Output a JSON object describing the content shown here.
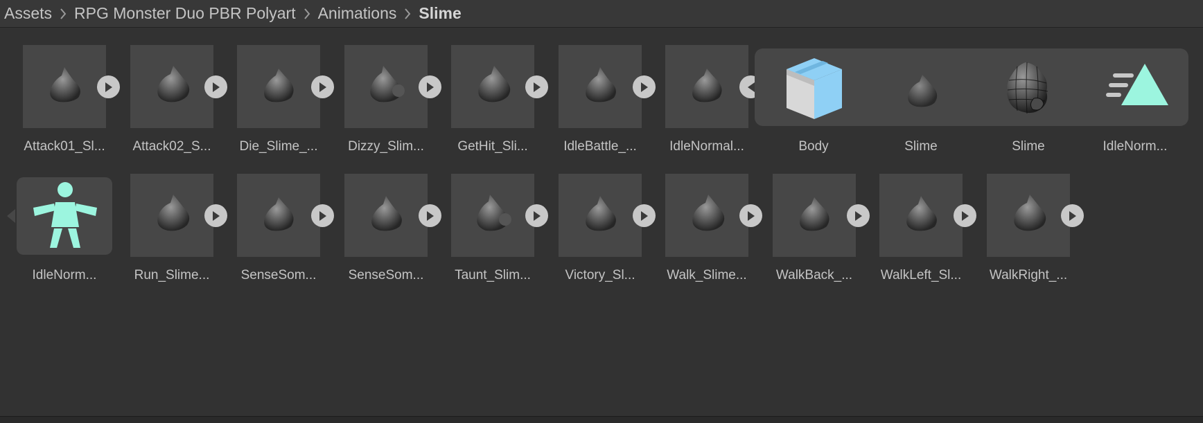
{
  "breadcrumb": {
    "items": [
      "Assets",
      "RPG Monster Duo PBR Polyart",
      "Animations",
      "Slime"
    ]
  },
  "row1": {
    "clips": [
      {
        "label": "Attack01_Sl...",
        "variant": 0
      },
      {
        "label": "Attack02_S...",
        "variant": 1
      },
      {
        "label": "Die_Slime_...",
        "variant": 2
      },
      {
        "label": "Dizzy_Slim...",
        "variant": 3
      },
      {
        "label": "GetHit_Sli...",
        "variant": 1
      },
      {
        "label": "IdleBattle_...",
        "variant": 0
      },
      {
        "label": "IdleNormal...",
        "variant": 2
      }
    ]
  },
  "expanded": {
    "sub_assets": [
      {
        "label": "Body",
        "icon": "package-icon"
      },
      {
        "label": "Slime",
        "icon": "slime-mesh-icon"
      },
      {
        "label": "Slime",
        "icon": "slime-wireframe-icon"
      },
      {
        "label": "IdleNorm...",
        "icon": "animation-clip-icon"
      }
    ]
  },
  "row2": {
    "avatar": {
      "label": "IdleNorm...",
      "icon": "avatar-humanoid-icon"
    },
    "clips": [
      {
        "label": "Run_Slime...",
        "variant": 1
      },
      {
        "label": "SenseSom...",
        "variant": 2
      },
      {
        "label": "SenseSom...",
        "variant": 0
      },
      {
        "label": "Taunt_Slim...",
        "variant": 3
      },
      {
        "label": "Victory_Sl...",
        "variant": 0
      },
      {
        "label": "Walk_Slime...",
        "variant": 1
      },
      {
        "label": "WalkBack_...",
        "variant": 2
      },
      {
        "label": "WalkLeft_Sl...",
        "variant": 0
      },
      {
        "label": "WalkRight_...",
        "variant": 1
      }
    ]
  },
  "colors": {
    "background": "#323232",
    "tile": "#474747",
    "play_button": "#c8c8c8",
    "package_blue": "#8fd0f5",
    "avatar_mint": "#9cf5df",
    "text": "#c4c4c4"
  }
}
